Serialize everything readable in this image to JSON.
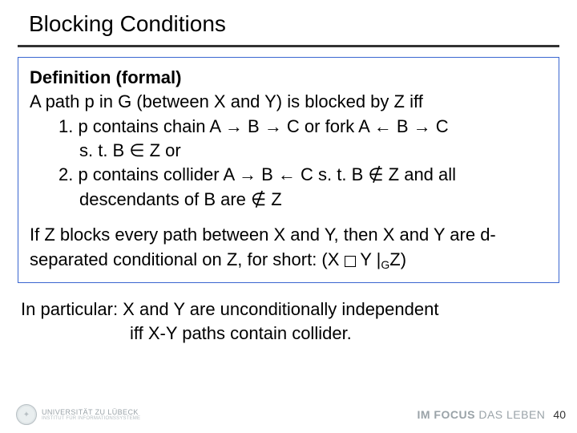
{
  "title": "Blocking Conditions",
  "def": {
    "header": "Definition (formal)",
    "line1": "A path p in G (between X and Y) is blocked by Z iff",
    "item1a": "1.  p contains chain A → B →  C or fork A ← B →  C",
    "item1b": "s. t. B  ∈   Z or",
    "item2a": "2.  p contains collider A →  B ← C s. t. B ∉ Z and all",
    "item2b": "descendants of B  are ∉ Z",
    "sep_pre": "If Z blocks every path between X and Y, then X and Y are d-separated conditional on Z, for short: (X ",
    "sep_mid": "  Y  |",
    "sep_sub": "G",
    "sep_post": "Z)"
  },
  "outside": {
    "line1": "In particular: X and Y are unconditionally independent",
    "line2": "iff X-Y  paths contain collider."
  },
  "footer": {
    "uni_line1": "UNIVERSITÄT ZU LÜBECK",
    "uni_line2": "INSTITUT FÜR INFORMATIONSSYSTEME",
    "focus_strong": "IM FOCUS",
    "focus_rest": " DAS LEBEN",
    "page": "40"
  }
}
